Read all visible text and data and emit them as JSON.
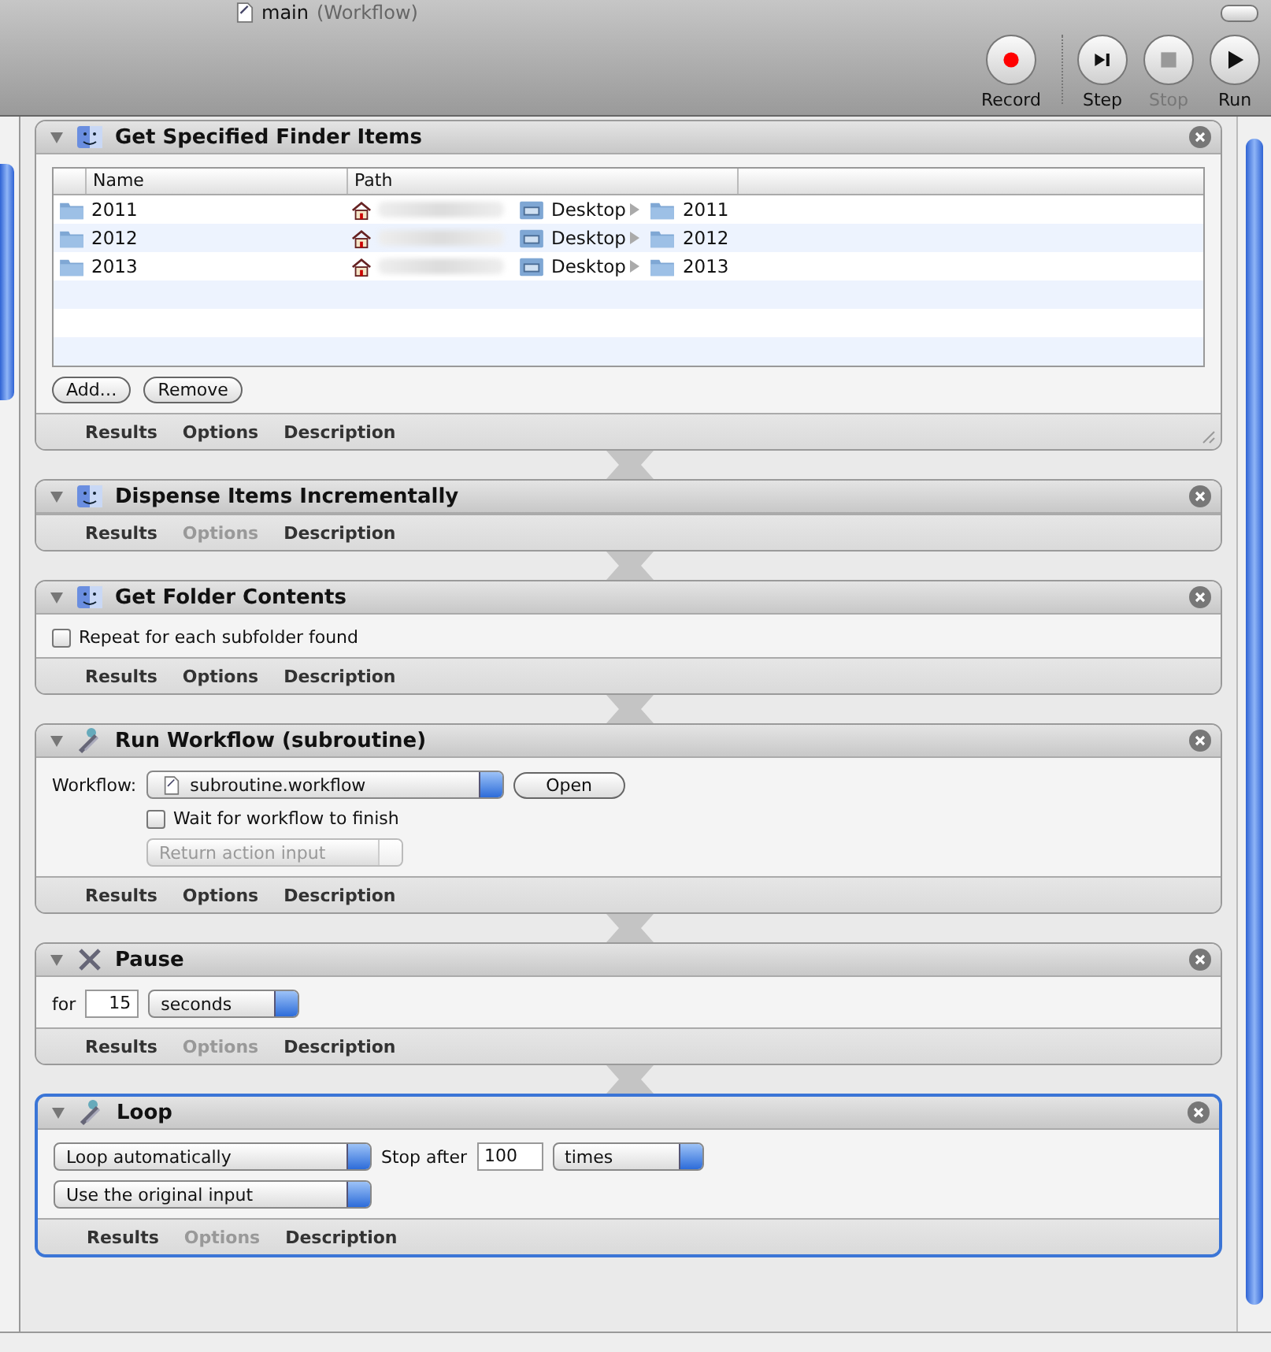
{
  "window": {
    "title": "main",
    "subtitle": "(Workflow)"
  },
  "toolbar": [
    {
      "label": "Record",
      "kind": "record",
      "disabled": false
    },
    {
      "label": "Step",
      "kind": "step",
      "disabled": false
    },
    {
      "label": "Stop",
      "kind": "stop",
      "disabled": true
    },
    {
      "label": "Run",
      "kind": "run",
      "disabled": false
    }
  ],
  "actions": [
    {
      "kind": "finder",
      "title": "Get Specified Finder Items",
      "selected": false,
      "expanded": true,
      "columns": [
        "Name",
        "Path"
      ],
      "rows": [
        {
          "name": "2011",
          "path": [
            "Desktop",
            "2011"
          ]
        },
        {
          "name": "2012",
          "path": [
            "Desktop",
            "2012"
          ]
        },
        {
          "name": "2013",
          "path": [
            "Desktop",
            "2013"
          ]
        }
      ],
      "buttons": [
        "Add…",
        "Remove"
      ],
      "tabs": [
        {
          "label": "Results",
          "disabled": false
        },
        {
          "label": "Options",
          "disabled": false
        },
        {
          "label": "Description",
          "disabled": false
        }
      ]
    },
    {
      "kind": "empty",
      "title": "Dispense Items Incrementally",
      "selected": false,
      "expanded": true,
      "tabs": [
        {
          "label": "Results",
          "disabled": false
        },
        {
          "label": "Options",
          "disabled": true
        },
        {
          "label": "Description",
          "disabled": false
        }
      ]
    },
    {
      "kind": "folder",
      "title": "Get Folder Contents",
      "selected": false,
      "expanded": true,
      "checkbox": {
        "label": "Repeat for each subfolder found",
        "checked": false
      },
      "tabs": [
        {
          "label": "Results",
          "disabled": false
        },
        {
          "label": "Options",
          "disabled": false
        },
        {
          "label": "Description",
          "disabled": false
        }
      ]
    },
    {
      "kind": "workflow",
      "title": "Run Workflow (subroutine)",
      "selected": false,
      "expanded": true,
      "field_label": "Workflow:",
      "popup": "subroutine.workflow",
      "button": "Open",
      "checkbox": {
        "label": "Wait for workflow to finish",
        "checked": false
      },
      "popup_2": {
        "value": "Return action input",
        "disabled": true
      },
      "tabs": [
        {
          "label": "Results",
          "disabled": false
        },
        {
          "label": "Options",
          "disabled": false
        },
        {
          "label": "Description",
          "disabled": false
        }
      ]
    },
    {
      "kind": "pause",
      "title": "Pause",
      "selected": false,
      "expanded": true,
      "field_label": "for",
      "value": "15",
      "popup": "seconds",
      "tabs": [
        {
          "label": "Results",
          "disabled": false
        },
        {
          "label": "Options",
          "disabled": true
        },
        {
          "label": "Description",
          "disabled": false
        }
      ]
    },
    {
      "kind": "loop",
      "title": "Loop",
      "selected": true,
      "expanded": true,
      "popup": "Loop automatically",
      "field_label": "Stop after",
      "value": "100",
      "popup_unit": "times",
      "popup_2": "Use the original input",
      "tabs": [
        {
          "label": "Results",
          "disabled": false
        },
        {
          "label": "Options",
          "disabled": true
        },
        {
          "label": "Description",
          "disabled": false
        }
      ]
    }
  ]
}
